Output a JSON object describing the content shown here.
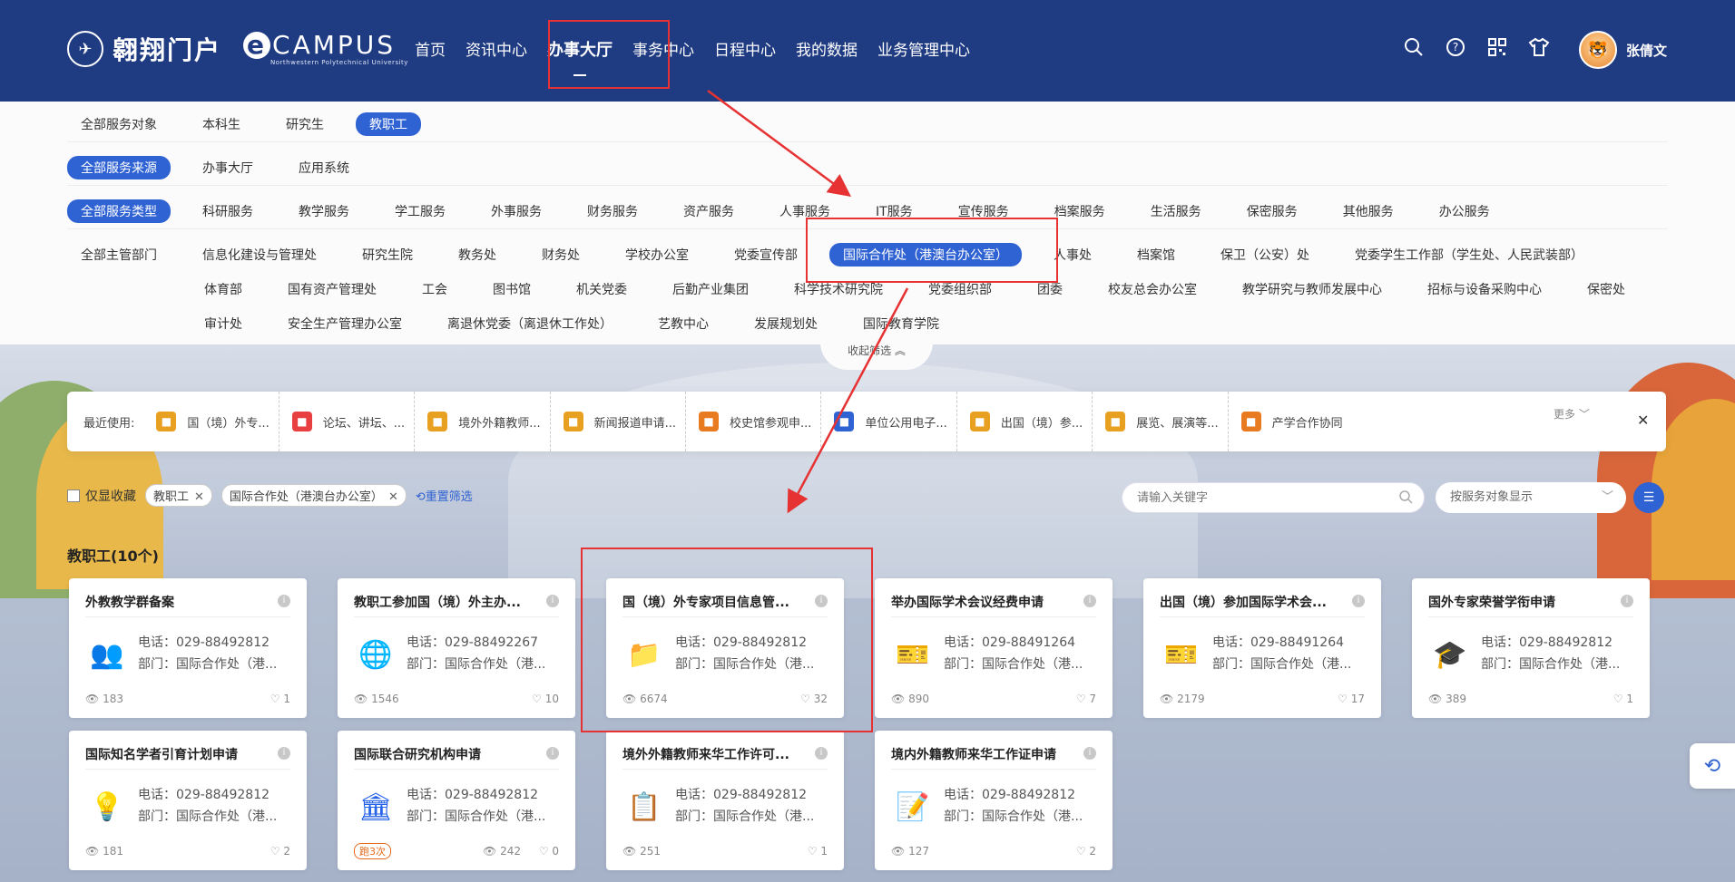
{
  "header": {
    "logo_cn": "翱翔门户",
    "logo_ecampus": "CAMPUS",
    "logo_e": "e",
    "logo_sub": "Northwestern Polytechnical University",
    "nav": [
      "首页",
      "资讯中心",
      "办事大厅",
      "事务中心",
      "日程中心",
      "我的数据",
      "业务管理中心"
    ],
    "active_nav": "办事大厅",
    "username": "张倩文",
    "icons": [
      "search-icon",
      "help-icon",
      "qrcode-icon",
      "skin-icon"
    ]
  },
  "filters": {
    "audience": [
      "全部服务对象",
      "本科生",
      "研究生",
      "教职工"
    ],
    "audience_selected": "教职工",
    "source": [
      "全部服务来源",
      "办事大厅",
      "应用系统"
    ],
    "source_selected": "全部服务来源",
    "type": [
      "全部服务类型",
      "科研服务",
      "教学服务",
      "学工服务",
      "外事服务",
      "财务服务",
      "资产服务",
      "人事服务",
      "IT服务",
      "宣传服务",
      "档案服务",
      "生活服务",
      "保密服务",
      "其他服务",
      "办公服务"
    ],
    "type_selected": "全部服务类型",
    "dept_row1": [
      "全部主管部门",
      "信息化建设与管理处",
      "研究生院",
      "教务处",
      "财务处",
      "学校办公室",
      "党委宣传部",
      "国际合作处（港澳台办公室）",
      "人事处",
      "档案馆",
      "保卫（公安）处",
      "党委学生工作部（学生处、人民武装部）"
    ],
    "dept_row2": [
      "体育部",
      "国有资产管理处",
      "工会",
      "图书馆",
      "机关党委",
      "后勤产业集团",
      "科学技术研究院",
      "党委组织部",
      "团委",
      "校友总会办公室",
      "教学研究与教师发展中心",
      "招标与设备采购中心",
      "保密处"
    ],
    "dept_row3": [
      "审计处",
      "安全生产管理办公室",
      "离退休党委（离退休工作处）",
      "艺教中心",
      "发展规划处",
      "国际教育学院"
    ],
    "dept_selected": "国际合作处（港澳台办公室）",
    "collapse_label": "收起筛选 ︽"
  },
  "recent": {
    "label": "最近使用:",
    "items": [
      {
        "text": "国（境）外专...",
        "icon": "folder-icon",
        "color": "#e8a020"
      },
      {
        "text": "论坛、讲坛、...",
        "icon": "gift-icon",
        "color": "#e84040"
      },
      {
        "text": "境外外籍教师...",
        "icon": "badge-icon",
        "color": "#e8a020"
      },
      {
        "text": "新闻报道申请...",
        "icon": "news-icon",
        "color": "#e8a020"
      },
      {
        "text": "校史馆参观申...",
        "icon": "building-icon",
        "color": "#e87a20"
      },
      {
        "text": "单位公用电子...",
        "icon": "mail-icon",
        "color": "#2f62d2"
      },
      {
        "text": "出国（境）参...",
        "icon": "plane-icon",
        "color": "#e8a020"
      },
      {
        "text": "展览、展演等...",
        "icon": "picture-icon",
        "color": "#e8a020"
      },
      {
        "text": "产学合作协同",
        "icon": "document-icon",
        "color": "#e87a20"
      }
    ],
    "more_label": "更多 ﹀",
    "close_label": "✕"
  },
  "toolbar": {
    "only_fav": "仅显收藏",
    "tags": [
      "教职工",
      "国际合作处（港澳台办公室）"
    ],
    "reset": "重置筛选",
    "search_placeholder": "请输入关键字",
    "display_select": "按服务对象显示"
  },
  "section_title": "教职工(10个)",
  "cards": [
    {
      "title": "外教教学群备案",
      "phone": "电话：029-88492812",
      "dept": "部门：国际合作处（港...",
      "views": "183",
      "likes": "1",
      "icon": "people-icon",
      "color": "#2f62d2",
      "glyph": "👥"
    },
    {
      "title": "教职工参加国（境）外主办...",
      "phone": "电话：029-88492267",
      "dept": "部门：国际合作处（港...",
      "views": "1546",
      "likes": "10",
      "icon": "globe-icon",
      "color": "#2f62d2",
      "glyph": "🌐"
    },
    {
      "title": "国（境）外专家项目信息管...",
      "phone": "电话：029-88492812",
      "dept": "部门：国际合作处（港...",
      "views": "6674",
      "likes": "32",
      "icon": "folder-icon",
      "color": "#e8a020",
      "glyph": "📁"
    },
    {
      "title": "举办国际学术会议经费申请",
      "phone": "电话：029-88491264",
      "dept": "部门：国际合作处（港...",
      "views": "890",
      "likes": "7",
      "icon": "ticket-icon",
      "color": "#e84040",
      "glyph": "🎫"
    },
    {
      "title": "出国（境）参加国际学术会...",
      "phone": "电话：029-88491264",
      "dept": "部门：国际合作处（港...",
      "views": "2179",
      "likes": "17",
      "icon": "ticket-icon",
      "color": "#e8a020",
      "glyph": "🎫"
    },
    {
      "title": "国外专家荣誉学衔申请",
      "phone": "电话：029-88492812",
      "dept": "部门：国际合作处（港...",
      "views": "389",
      "likes": "1",
      "icon": "graduate-icon",
      "color": "#1fa060",
      "glyph": "🎓"
    },
    {
      "title": "国际知名学者引育计划申请",
      "phone": "电话：029-88492812",
      "dept": "部门：国际合作处（港...",
      "views": "181",
      "likes": "2",
      "icon": "bulb-icon",
      "color": "#1fa060",
      "glyph": "💡"
    },
    {
      "title": "国际联合研究机构申请",
      "phone": "电话：029-88492812",
      "dept": "部门：国际合作处（港...",
      "views": "242",
      "likes": "0",
      "icon": "institution-icon",
      "color": "#2f62d2",
      "glyph": "🏛",
      "badge": "跑3次"
    },
    {
      "title": "境外外籍教师来华工作许可...",
      "phone": "电话：029-88492812",
      "dept": "部门：国际合作处（港...",
      "views": "251",
      "likes": "1",
      "icon": "badge-icon",
      "color": "#e8a020",
      "glyph": "📋"
    },
    {
      "title": "境内外籍教师来华工作证申请",
      "phone": "电话：029-88492812",
      "dept": "部门：国际合作处（港...",
      "views": "127",
      "likes": "2",
      "icon": "clipboard-icon",
      "color": "#e87a20",
      "glyph": "📝"
    }
  ]
}
